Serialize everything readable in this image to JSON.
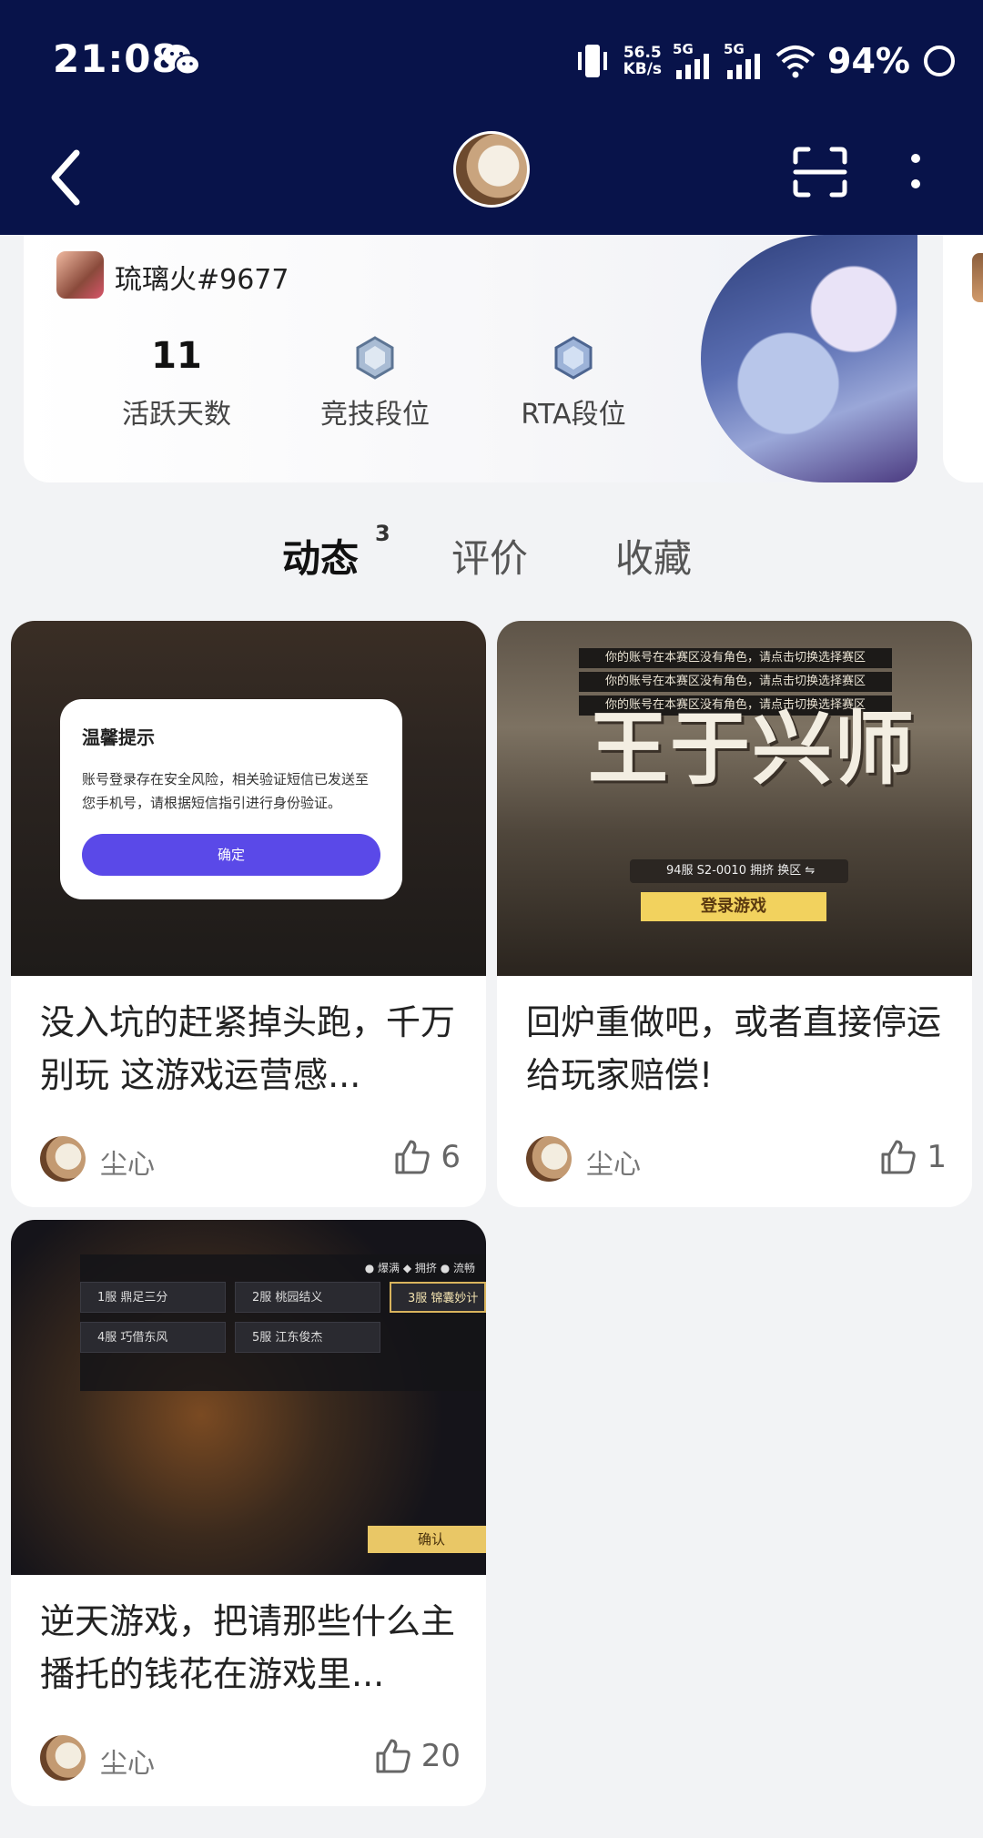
{
  "status_bar": {
    "time": "21:08",
    "net_speed_value": "56.5",
    "net_speed_unit": "KB/s",
    "signal_1": "5G",
    "signal_2": "5G",
    "battery": "94%"
  },
  "game": {
    "name": "琉璃火#9677",
    "stats": [
      {
        "value": "11",
        "label": "活跃天数"
      },
      {
        "value": "",
        "label": "竞技段位"
      },
      {
        "value": "",
        "label": "RTA段位"
      }
    ]
  },
  "tabs": [
    {
      "label": "动态",
      "badge": "3",
      "active": true
    },
    {
      "label": "评价",
      "active": false
    },
    {
      "label": "收藏",
      "active": false
    }
  ],
  "posts": [
    {
      "title": "没入坑的赶紧掉头跑，千万别玩 这游戏运营感...",
      "author": "尘心",
      "likes": "6",
      "image": {
        "dialog_title": "温馨提示",
        "dialog_text": "账号登录存在安全风险，相关验证短信已发送至您手机号，请根据短信指引进行身份验证。",
        "dialog_button": "确定"
      }
    },
    {
      "title": "回炉重做吧，或者直接停运给玩家赔偿!",
      "author": "尘心",
      "likes": "1",
      "image": {
        "notices": [
          "你的账号在本赛区没有角色，请点击切换选择赛区",
          "你的账号在本赛区没有角色，请点击切换选择赛区",
          "你的账号在本赛区没有角色，请点击切换选择赛区"
        ],
        "calligraphy": "王于兴师",
        "server_text": "94服  S2-0010  拥挤  换区 ⇋",
        "login_button": "登录游戏"
      }
    },
    {
      "title": "逆天游戏，把请那些什么主播托的钱花在游戏里...",
      "author": "尘心",
      "likes": "20",
      "image": {
        "legend": "● 爆满   ◆ 拥挤   ● 流畅",
        "servers": [
          "1服 鼎足三分",
          "2服 桃园结义",
          "3服 锦囊妙计",
          "4服 巧借东风",
          "5服 江东俊杰"
        ],
        "confirm": "确认"
      }
    }
  ],
  "colors": {
    "topbar": "#08134a",
    "tab_underline": "#3fd7c0",
    "dialog_button": "#5a49e8"
  }
}
